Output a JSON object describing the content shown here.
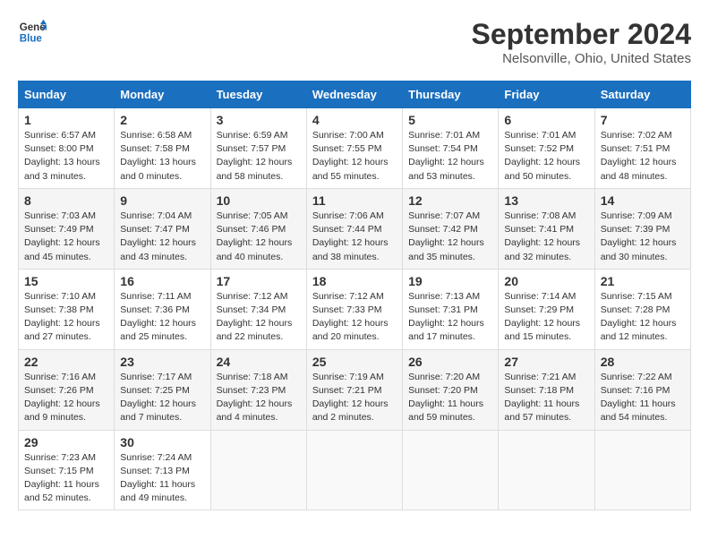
{
  "header": {
    "logo_line1": "General",
    "logo_line2": "Blue",
    "month_title": "September 2024",
    "subtitle": "Nelsonville, Ohio, United States"
  },
  "columns": [
    "Sunday",
    "Monday",
    "Tuesday",
    "Wednesday",
    "Thursday",
    "Friday",
    "Saturday"
  ],
  "weeks": [
    [
      {
        "day": "1",
        "info": "Sunrise: 6:57 AM\nSunset: 8:00 PM\nDaylight: 13 hours\nand 3 minutes."
      },
      {
        "day": "2",
        "info": "Sunrise: 6:58 AM\nSunset: 7:58 PM\nDaylight: 13 hours\nand 0 minutes."
      },
      {
        "day": "3",
        "info": "Sunrise: 6:59 AM\nSunset: 7:57 PM\nDaylight: 12 hours\nand 58 minutes."
      },
      {
        "day": "4",
        "info": "Sunrise: 7:00 AM\nSunset: 7:55 PM\nDaylight: 12 hours\nand 55 minutes."
      },
      {
        "day": "5",
        "info": "Sunrise: 7:01 AM\nSunset: 7:54 PM\nDaylight: 12 hours\nand 53 minutes."
      },
      {
        "day": "6",
        "info": "Sunrise: 7:01 AM\nSunset: 7:52 PM\nDaylight: 12 hours\nand 50 minutes."
      },
      {
        "day": "7",
        "info": "Sunrise: 7:02 AM\nSunset: 7:51 PM\nDaylight: 12 hours\nand 48 minutes."
      }
    ],
    [
      {
        "day": "8",
        "info": "Sunrise: 7:03 AM\nSunset: 7:49 PM\nDaylight: 12 hours\nand 45 minutes."
      },
      {
        "day": "9",
        "info": "Sunrise: 7:04 AM\nSunset: 7:47 PM\nDaylight: 12 hours\nand 43 minutes."
      },
      {
        "day": "10",
        "info": "Sunrise: 7:05 AM\nSunset: 7:46 PM\nDaylight: 12 hours\nand 40 minutes."
      },
      {
        "day": "11",
        "info": "Sunrise: 7:06 AM\nSunset: 7:44 PM\nDaylight: 12 hours\nand 38 minutes."
      },
      {
        "day": "12",
        "info": "Sunrise: 7:07 AM\nSunset: 7:42 PM\nDaylight: 12 hours\nand 35 minutes."
      },
      {
        "day": "13",
        "info": "Sunrise: 7:08 AM\nSunset: 7:41 PM\nDaylight: 12 hours\nand 32 minutes."
      },
      {
        "day": "14",
        "info": "Sunrise: 7:09 AM\nSunset: 7:39 PM\nDaylight: 12 hours\nand 30 minutes."
      }
    ],
    [
      {
        "day": "15",
        "info": "Sunrise: 7:10 AM\nSunset: 7:38 PM\nDaylight: 12 hours\nand 27 minutes."
      },
      {
        "day": "16",
        "info": "Sunrise: 7:11 AM\nSunset: 7:36 PM\nDaylight: 12 hours\nand 25 minutes."
      },
      {
        "day": "17",
        "info": "Sunrise: 7:12 AM\nSunset: 7:34 PM\nDaylight: 12 hours\nand 22 minutes."
      },
      {
        "day": "18",
        "info": "Sunrise: 7:12 AM\nSunset: 7:33 PM\nDaylight: 12 hours\nand 20 minutes."
      },
      {
        "day": "19",
        "info": "Sunrise: 7:13 AM\nSunset: 7:31 PM\nDaylight: 12 hours\nand 17 minutes."
      },
      {
        "day": "20",
        "info": "Sunrise: 7:14 AM\nSunset: 7:29 PM\nDaylight: 12 hours\nand 15 minutes."
      },
      {
        "day": "21",
        "info": "Sunrise: 7:15 AM\nSunset: 7:28 PM\nDaylight: 12 hours\nand 12 minutes."
      }
    ],
    [
      {
        "day": "22",
        "info": "Sunrise: 7:16 AM\nSunset: 7:26 PM\nDaylight: 12 hours\nand 9 minutes."
      },
      {
        "day": "23",
        "info": "Sunrise: 7:17 AM\nSunset: 7:25 PM\nDaylight: 12 hours\nand 7 minutes."
      },
      {
        "day": "24",
        "info": "Sunrise: 7:18 AM\nSunset: 7:23 PM\nDaylight: 12 hours\nand 4 minutes."
      },
      {
        "day": "25",
        "info": "Sunrise: 7:19 AM\nSunset: 7:21 PM\nDaylight: 12 hours\nand 2 minutes."
      },
      {
        "day": "26",
        "info": "Sunrise: 7:20 AM\nSunset: 7:20 PM\nDaylight: 11 hours\nand 59 minutes."
      },
      {
        "day": "27",
        "info": "Sunrise: 7:21 AM\nSunset: 7:18 PM\nDaylight: 11 hours\nand 57 minutes."
      },
      {
        "day": "28",
        "info": "Sunrise: 7:22 AM\nSunset: 7:16 PM\nDaylight: 11 hours\nand 54 minutes."
      }
    ],
    [
      {
        "day": "29",
        "info": "Sunrise: 7:23 AM\nSunset: 7:15 PM\nDaylight: 11 hours\nand 52 minutes."
      },
      {
        "day": "30",
        "info": "Sunrise: 7:24 AM\nSunset: 7:13 PM\nDaylight: 11 hours\nand 49 minutes."
      },
      {
        "day": "",
        "info": ""
      },
      {
        "day": "",
        "info": ""
      },
      {
        "day": "",
        "info": ""
      },
      {
        "day": "",
        "info": ""
      },
      {
        "day": "",
        "info": ""
      }
    ]
  ]
}
